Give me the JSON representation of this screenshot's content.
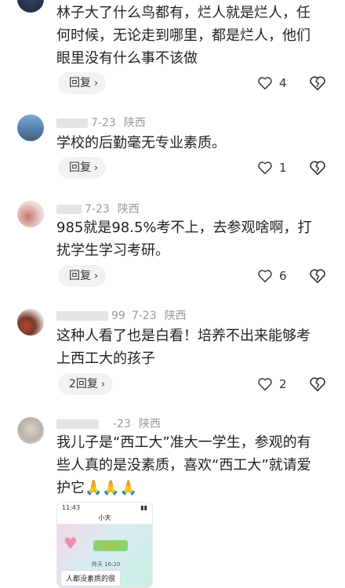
{
  "comments": [
    {
      "user": "",
      "date": "",
      "location": "",
      "text": "林子大了什么鸟都有，烂人就是烂人，任何时候，无论走到哪里，都是烂人，他们眼里没有什么事不该做",
      "reply_label": "回复",
      "likes": "4"
    },
    {
      "user": "",
      "date": "7-23",
      "location": "陕西",
      "text": "学校的后勤毫无专业素质。",
      "reply_label": "回复",
      "likes": "1"
    },
    {
      "user": "",
      "date": "7-23",
      "location": "陕西",
      "text": "985就是98.5%考不上，去参观啥啊，打扰学生学习考研。",
      "reply_label": "回复",
      "likes": "6"
    },
    {
      "user": "99",
      "date": "7-23",
      "location": "陕西",
      "text": "这种人看了也是白看！培养不出来能够考上西工大的孩子",
      "reply_label": "2回复",
      "likes": "2"
    },
    {
      "user": "",
      "date": "-23",
      "location": "陕西",
      "text": "我儿子是“西工大”准大一学生，参观的有些人真的是没素质，喜欢“西工大”就请爱护它🙏🙏🙏",
      "reply_label": "",
      "likes": ""
    }
  ],
  "reply_chevron": "›",
  "icons": {
    "like": "heart-outline-icon",
    "dislike": "broken-heart-icon"
  },
  "thumbnail": {
    "status_time": "11:43",
    "title": "小天",
    "time_label": "昨天 16:20",
    "message": "人都没素质的很"
  },
  "colors": {
    "text": "#222222",
    "meta": "#9a9a9a",
    "reply_bg": "#f2f2f2"
  }
}
